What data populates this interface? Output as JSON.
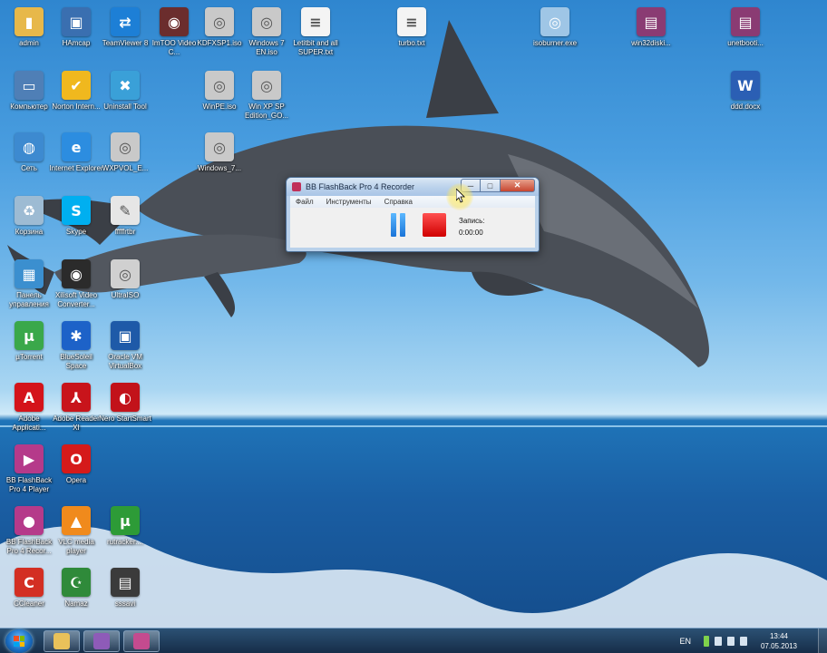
{
  "desktop_icons": [
    {
      "label": "admin",
      "color": "#e7b84a",
      "symbol": "▮"
    },
    {
      "label": "HAmcap",
      "color": "#3a6fb0",
      "symbol": "▣"
    },
    {
      "label": "TeamViewer 8",
      "color": "#1d7fd6",
      "symbol": "⇄"
    },
    {
      "label": "ImTOO Video C...",
      "color": "#6b2d2d",
      "symbol": "◉"
    },
    {
      "label": "KDFXSP1.iso",
      "color": "#c9c9c9",
      "symbol": "◎"
    },
    {
      "label": "Windows 7 EN.iso",
      "color": "#c9c9c9",
      "symbol": "◎"
    },
    {
      "label": "Letitbit and all SUPER.txt",
      "color": "#f4f4f4",
      "symbol": "≡"
    },
    {
      "label": "turbo.txt",
      "color": "#f4f4f4",
      "symbol": "≡"
    },
    {
      "label": "isoburner.exe",
      "color": "#9fc6e6",
      "symbol": "◎"
    },
    {
      "label": "win32diski...",
      "color": "#8a3b73",
      "symbol": "▤"
    },
    {
      "label": "unetbooti...",
      "color": "#8a3b73",
      "symbol": "▤"
    },
    {
      "label": "Компьютер",
      "color": "#4f7fb6",
      "symbol": "▭"
    },
    {
      "label": "Norton Intern...",
      "color": "#f0b81e",
      "symbol": "✔"
    },
    {
      "label": "Uninstall Tool",
      "color": "#3aa0d8",
      "symbol": "✖"
    },
    {
      "label": "WinPE.iso",
      "color": "#c9c9c9",
      "symbol": "◎"
    },
    {
      "label": "Win XP SP Edition_GO...",
      "color": "#c9c9c9",
      "symbol": "◎"
    },
    {
      "label": "ddd.docx",
      "color": "#2b5fb4",
      "symbol": "W"
    },
    {
      "label": "Сеть",
      "color": "#3d8ad0",
      "symbol": "◍"
    },
    {
      "label": "Internet Explorer",
      "color": "#2c8de0",
      "symbol": "e"
    },
    {
      "label": "WXPVOL_E...",
      "color": "#c9c9c9",
      "symbol": "◎"
    },
    {
      "label": "Windows_7...",
      "color": "#c9c9c9",
      "symbol": "◎"
    },
    {
      "label": "Корзина",
      "color": "#9dbbd3",
      "symbol": "♻"
    },
    {
      "label": "Skype",
      "color": "#00aff0",
      "symbol": "S"
    },
    {
      "label": "fffffrtbr",
      "color": "#e6e6e6",
      "symbol": "✎"
    },
    {
      "label": "Панель управления",
      "color": "#3b8fcf",
      "symbol": "▦"
    },
    {
      "label": "Xilisoft Video Converter...",
      "color": "#2b2b2b",
      "symbol": "◉"
    },
    {
      "label": "UltraISO",
      "color": "#d0d0d0",
      "symbol": "◎"
    },
    {
      "label": "µTorrent",
      "color": "#3aa84a",
      "symbol": "µ"
    },
    {
      "label": "BlueSoleil Space",
      "color": "#1d62c8",
      "symbol": "✱"
    },
    {
      "label": "Oracle VM VirtualBox",
      "color": "#1e5aa8",
      "symbol": "▣"
    },
    {
      "label": "Adobe Applicati...",
      "color": "#d4131a",
      "symbol": "A"
    },
    {
      "label": "Adobe Reader XI",
      "color": "#c8141b",
      "symbol": "⅄"
    },
    {
      "label": "Nero StartSmart",
      "color": "#c2121a",
      "symbol": "◐"
    },
    {
      "label": "BB FlashBack Pro 4 Player",
      "color": "#b53a8a",
      "symbol": "▶"
    },
    {
      "label": "Opera",
      "color": "#d51a1a",
      "symbol": "O"
    },
    {
      "label": "BB FlashBack Pro 4 Recor...",
      "color": "#b53a8a",
      "symbol": "●"
    },
    {
      "label": "VLC media player",
      "color": "#f08a1c",
      "symbol": "▲"
    },
    {
      "label": "rutracker....",
      "color": "#2d9b37",
      "symbol": "µ"
    },
    {
      "label": "CCleaner",
      "color": "#d32f23",
      "symbol": "C"
    },
    {
      "label": "Namaz",
      "color": "#2f8a3a",
      "symbol": "☪"
    },
    {
      "label": "sssavi",
      "color": "#3b3b3b",
      "symbol": "▤"
    }
  ],
  "app_window": {
    "title": "BB FlashBack Pro 4 Recorder",
    "min_glyph": "─",
    "max_glyph": "□",
    "close_glyph": "✕",
    "menu": [
      "Файл",
      "Инструменты",
      "Справка"
    ],
    "record_label": "Запись:",
    "record_time": "0:00:00"
  },
  "taskbar": {
    "pinned": [
      {
        "name": "explorer",
        "color": "#e9c15a"
      },
      {
        "name": "visual-studio",
        "color": "#8e5bb8"
      },
      {
        "name": "flashback-recorder",
        "color": "#c44b8f"
      }
    ],
    "language": "EN",
    "time": "13:44",
    "date": "07.05.2013"
  }
}
